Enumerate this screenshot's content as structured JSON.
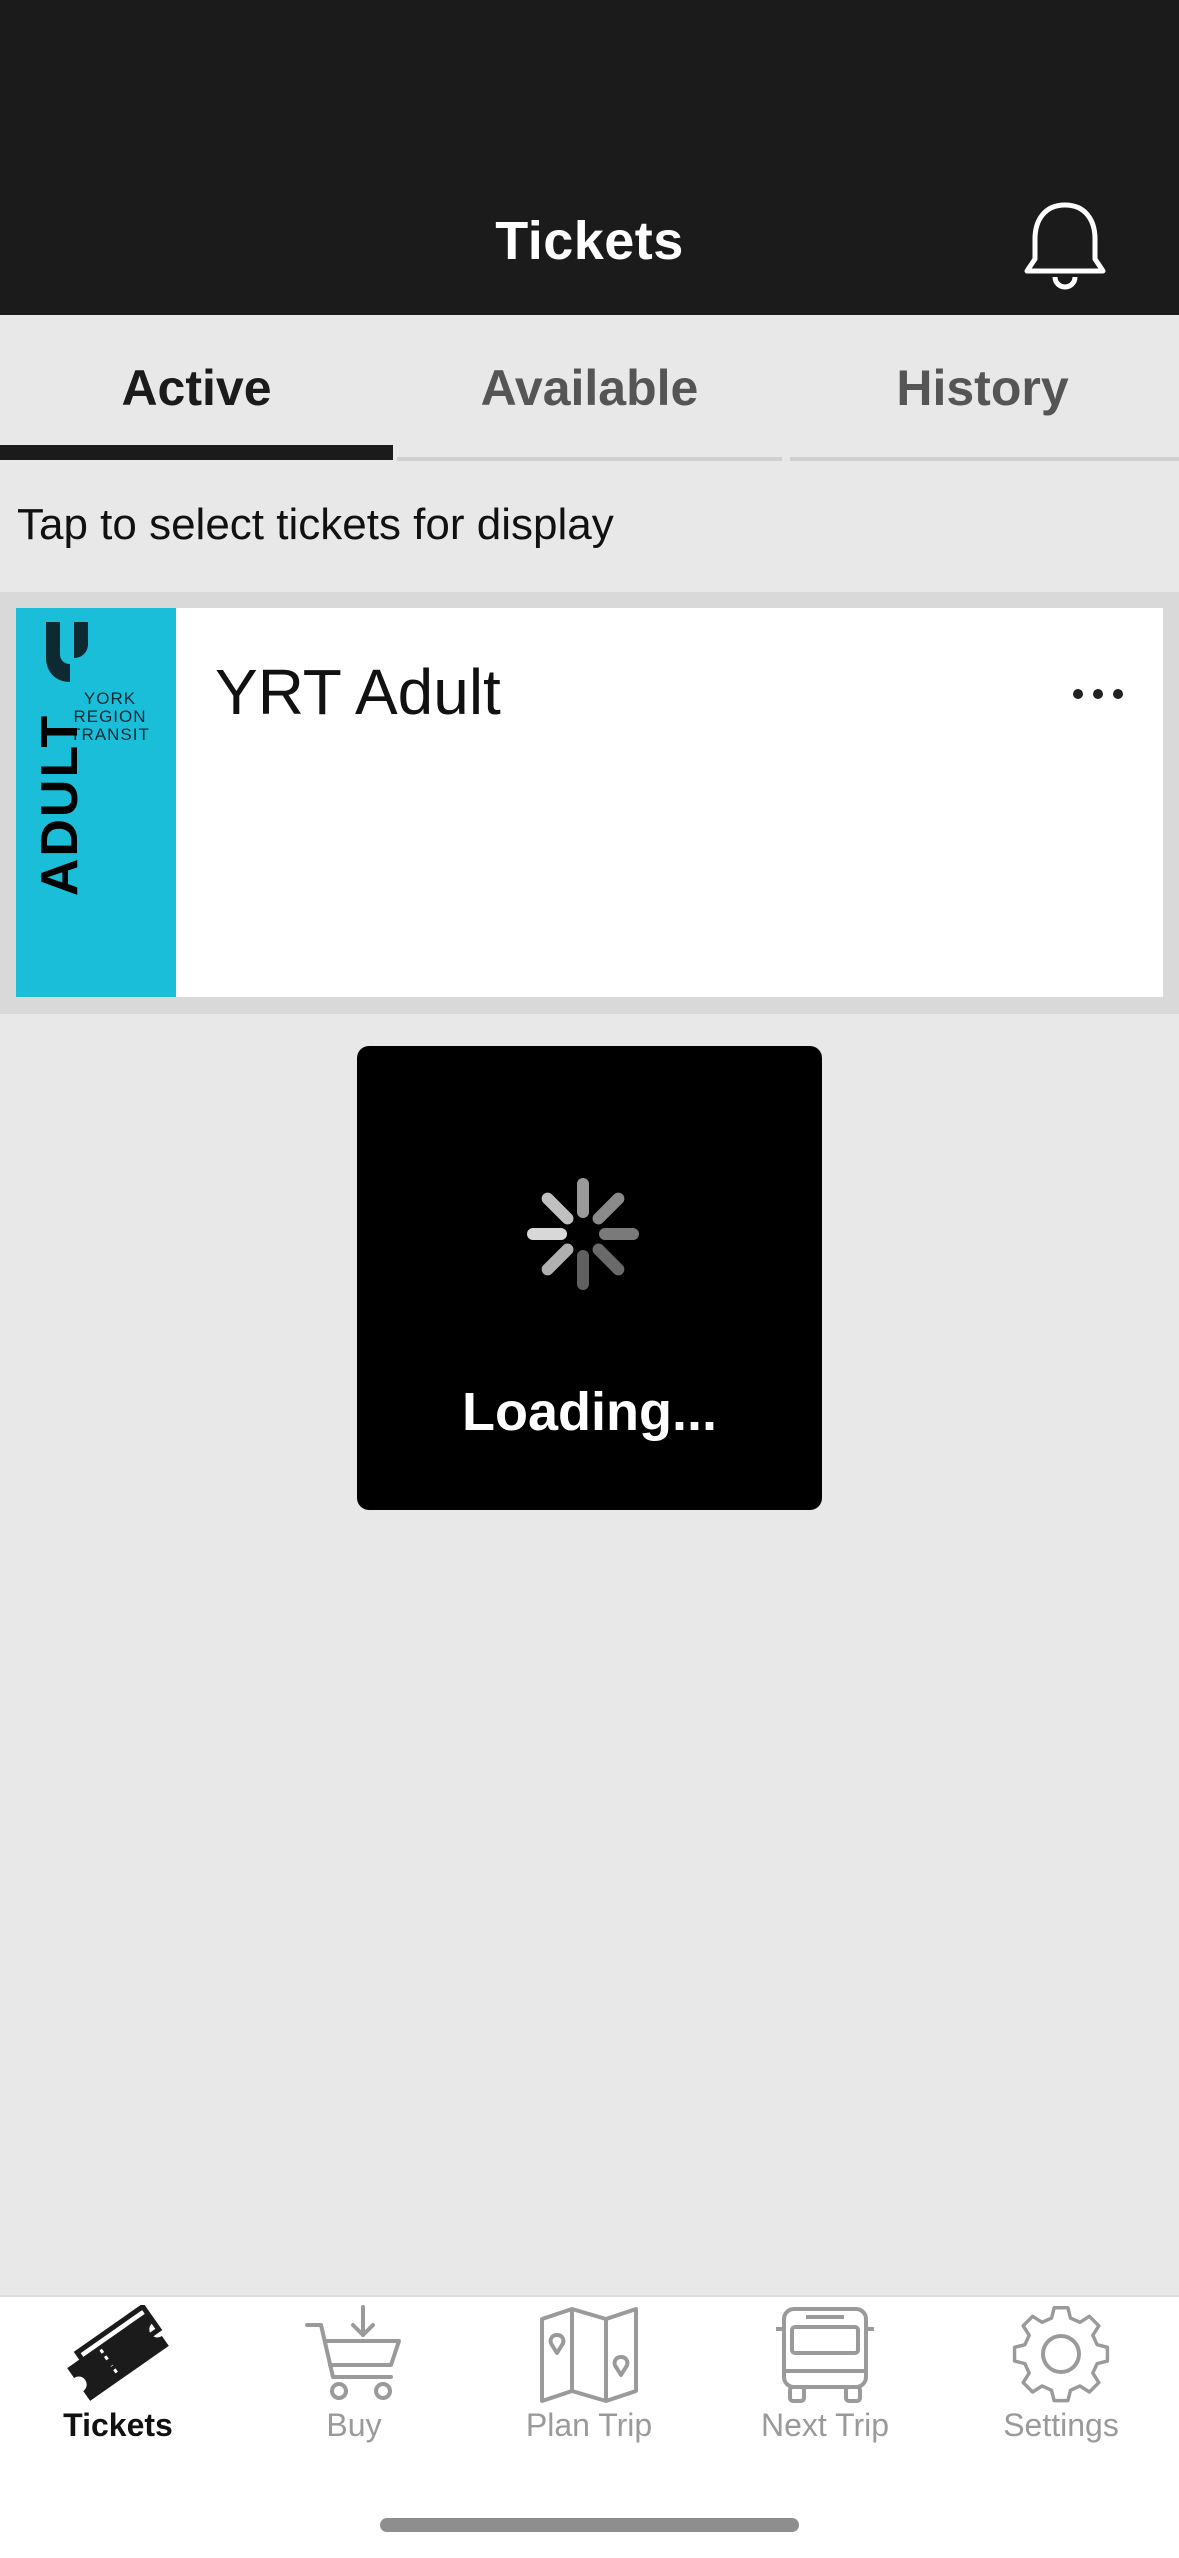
{
  "header": {
    "title": "Tickets",
    "bell_icon": "bell-icon"
  },
  "tabs": [
    {
      "label": "Active",
      "active": true
    },
    {
      "label": "Available",
      "active": false
    },
    {
      "label": "History",
      "active": false
    }
  ],
  "prompt": "Tap to select tickets for display",
  "ticket": {
    "brand_lines": [
      "YORK",
      "REGION",
      "TRANSIT"
    ],
    "stub_label": "ADULT",
    "name": "YRT Adult",
    "more_icon": "more-horizontal-icon",
    "stub_color": "#1bbed9"
  },
  "loading": {
    "text": "Loading...",
    "icon": "spinner-icon"
  },
  "bottom_nav": [
    {
      "label": "Tickets",
      "icon": "ticket-icon",
      "active": true
    },
    {
      "label": "Buy",
      "icon": "cart-icon",
      "active": false
    },
    {
      "label": "Plan Trip",
      "icon": "map-icon",
      "active": false
    },
    {
      "label": "Next Trip",
      "icon": "bus-icon",
      "active": false
    },
    {
      "label": "Settings",
      "icon": "gear-icon",
      "active": false
    }
  ]
}
